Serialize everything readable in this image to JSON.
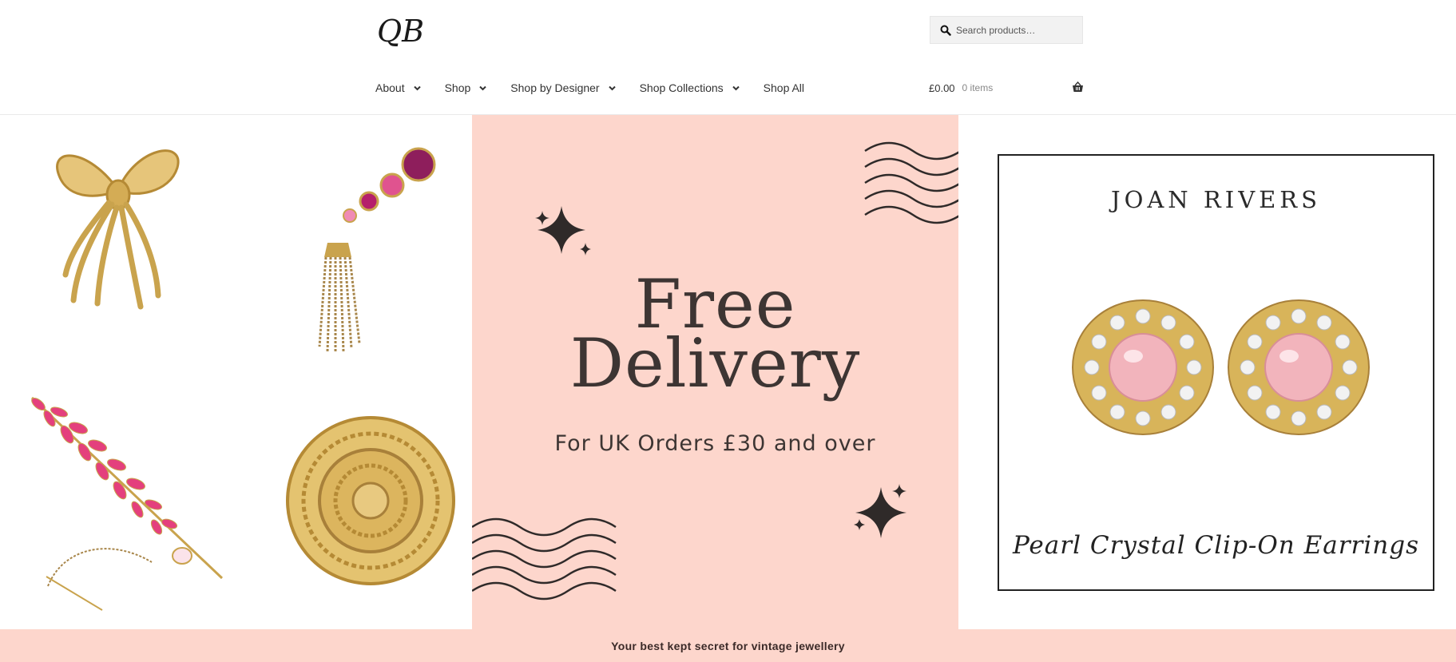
{
  "header": {
    "logo_text": "QB",
    "search": {
      "placeholder": "Search products…",
      "value": ""
    },
    "nav": [
      {
        "label": "About",
        "has_dropdown": true
      },
      {
        "label": "Shop",
        "has_dropdown": true
      },
      {
        "label": "Shop by Designer",
        "has_dropdown": true
      },
      {
        "label": "Shop Collections",
        "has_dropdown": true
      },
      {
        "label": "Shop All",
        "has_dropdown": false
      }
    ],
    "cart": {
      "amount": "£0.00",
      "items": "0 items"
    }
  },
  "banner": {
    "slides": [
      {
        "content": "brooch-collage",
        "icons": [
          "gold-bow-brooch",
          "pink-tassel-brooch",
          "pink-leaf-brooch",
          "gold-flower-brooch"
        ]
      },
      {
        "content": "promo",
        "title_line1": "Free",
        "title_line2": "Delivery",
        "subtitle": "For UK Orders £30 and over",
        "background": "#fdd6cc"
      },
      {
        "content": "product",
        "brand": "JOAN RIVERS",
        "caption": "Pearl Crystal Clip-On Earrings"
      }
    ]
  },
  "strip": {
    "text": "Your best kept secret for vintage jewellery",
    "background": "#fdd6cc"
  },
  "colors": {
    "accent_pink": "#fdd6cc",
    "text_dark": "#333333",
    "gold": "#c9a34d"
  }
}
